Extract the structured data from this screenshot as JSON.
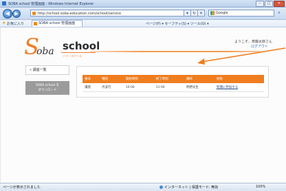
{
  "browser": {
    "window_title": "SOBA school 管理画面 - Windows Internet Explorer",
    "address": "http://school.soba-education.com/school/service",
    "search_engine": "Google",
    "favorites_label": "お気に入り",
    "tab_title": "SOBA school 管理画面",
    "toolbar_items": "ページ(P) ▾  セーフティ(S) ▾  ツール(O) ▾"
  },
  "header": {
    "logo_s": "S",
    "logo_soba": "oba",
    "logo_school": "school",
    "logo_tagline": "ソバ・スクール",
    "user_greeting": "ようこそ、斎藤太郎さん",
    "logout": "ログアウト"
  },
  "sidebar": {
    "back_label": "« 講座一覧",
    "button_line1": "SOBA school を",
    "button_line2": "ダウンロード"
  },
  "table": {
    "columns": [
      "番号",
      "種別",
      "開始時刻",
      "終了時刻",
      "講師",
      "状態"
    ],
    "rows": [
      {
        "cells": [
          "講座",
          "丹波行",
          "10:00",
          "11:00",
          "青野光生"
        ],
        "action": "受講に参加する"
      }
    ]
  },
  "statusbar": {
    "left": "ページが表示されました",
    "zone": "インターネット | 保護モード: 無効",
    "zoom": "100%"
  },
  "colors": {
    "accent": "#f07d1e",
    "logo_orange": "#f47a20",
    "sidebar_button": "#9b9b9b"
  }
}
